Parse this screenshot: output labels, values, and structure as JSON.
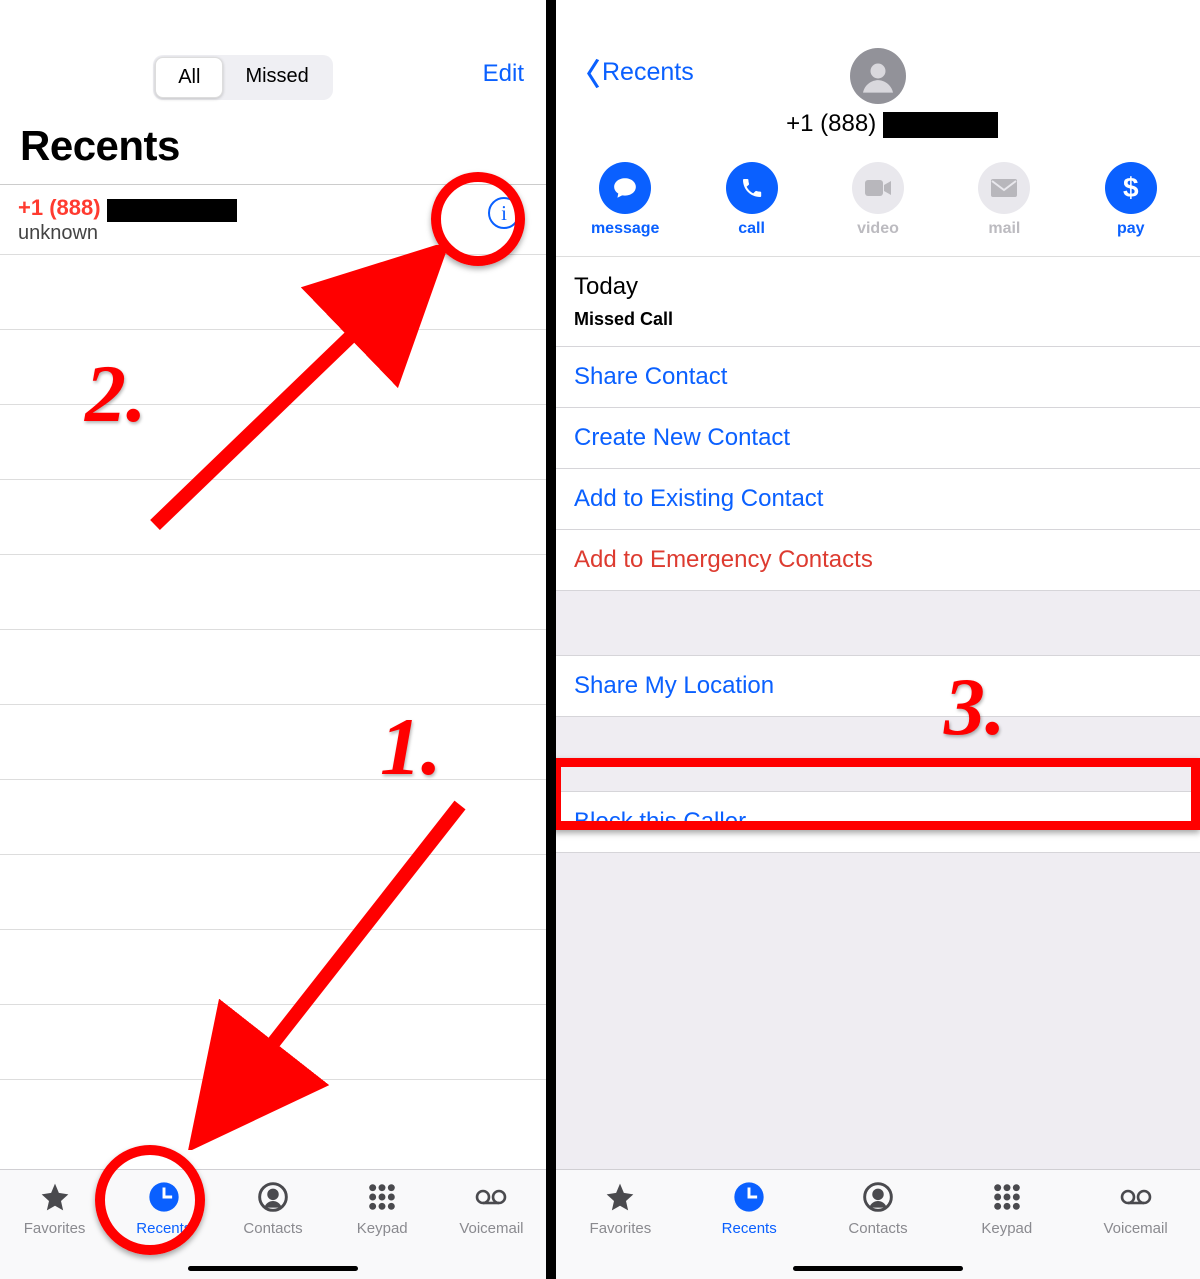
{
  "colors": {
    "blue": "#0a60ff",
    "red": "#ff3b30",
    "grayicon": "#8a8a8f"
  },
  "left": {
    "segmented": {
      "all": "All",
      "missed": "Missed"
    },
    "edit": "Edit",
    "title": "Recents",
    "call": {
      "number_prefix": "+1 (888)",
      "subtitle": "unknown"
    }
  },
  "tabs": {
    "favorites": "Favorites",
    "recents": "Recents",
    "contacts": "Contacts",
    "keypad": "Keypad",
    "voicemail": "Voicemail"
  },
  "right": {
    "back": "Recents",
    "phone_prefix": "+1 (888)",
    "actions": {
      "message": "message",
      "call": "call",
      "video": "video",
      "mail": "mail",
      "pay": "pay"
    },
    "today": "Today",
    "missed_call": "Missed Call",
    "share_contact": "Share Contact",
    "create_contact": "Create New Contact",
    "add_existing": "Add to Existing Contact",
    "add_emergency": "Add to Emergency Contacts",
    "share_location": "Share My Location",
    "block": "Block this Caller"
  },
  "annotations": {
    "step1": "1.",
    "step2": "2.",
    "step3": "3."
  }
}
